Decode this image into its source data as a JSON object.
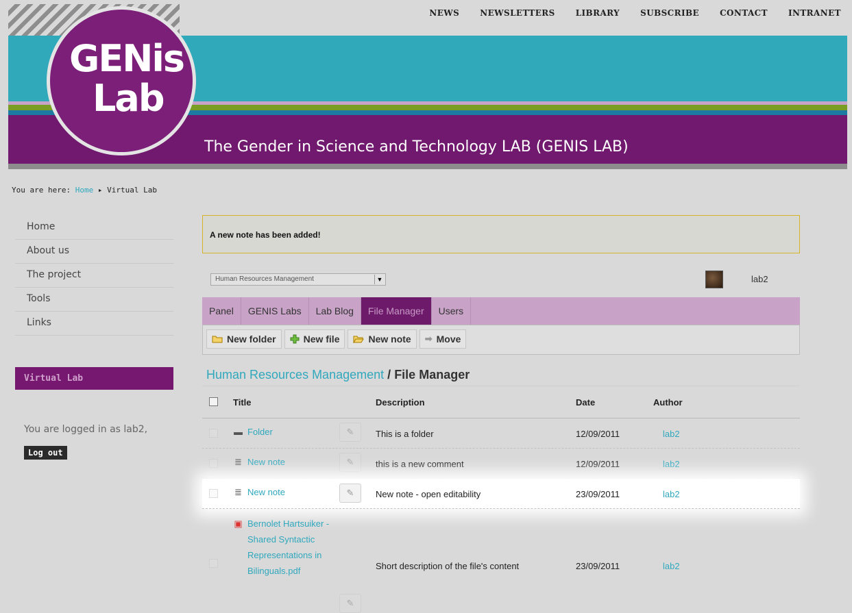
{
  "topnav": [
    "NEWS",
    "NEWSLETTERS",
    "LIBRARY",
    "SUBSCRIBE",
    "CONTACT",
    "INTRANET"
  ],
  "logo": {
    "line1": "GENis",
    "line2": "Lab"
  },
  "site_title": "The Gender in Science and Technology LAB (GENIS LAB)",
  "breadcrumb": {
    "prefix": "You are here:",
    "home": "Home",
    "separator": "▸",
    "current": "Virtual Lab"
  },
  "sidebar": {
    "items": [
      "Home",
      "About us",
      "The project",
      "Tools",
      "Links"
    ],
    "section_title": "Virtual Lab",
    "logged_in_text": "You are logged in as lab2,",
    "logout_label": "Log out"
  },
  "notice": "A new note has been added!",
  "lab_select": {
    "value": "Human Resources Management"
  },
  "user": {
    "name": "lab2"
  },
  "tabs": [
    {
      "label": "Panel",
      "active": false
    },
    {
      "label": "GENIS Labs",
      "active": false
    },
    {
      "label": "Lab Blog",
      "active": false
    },
    {
      "label": "File Manager",
      "active": true
    },
    {
      "label": "Users",
      "active": false
    }
  ],
  "toolbar": {
    "new_folder": "New folder",
    "new_file": "New file",
    "new_note": "New note",
    "move": "Move"
  },
  "file_manager": {
    "lab_link": "Human Resources Management",
    "separator": "/",
    "title": "File Manager",
    "columns": {
      "title": "Title",
      "description": "Description",
      "date": "Date",
      "author": "Author"
    },
    "rows": [
      {
        "type": "folder",
        "title": "Folder",
        "description": "This is a folder",
        "date": "12/09/2011",
        "author": "lab2"
      },
      {
        "type": "note",
        "title": "New note",
        "description": "this is a new comment",
        "date": "12/09/2011",
        "author": "lab2"
      },
      {
        "type": "note",
        "title": "New note",
        "description": "New note - open editability",
        "date": "23/09/2011",
        "author": "lab2"
      },
      {
        "type": "pdf",
        "title": [
          "Bernolet Hartsuiker -",
          "Shared Syntactic",
          "Representations in",
          "Bilinguals.pdf"
        ],
        "description": "Short description of the file's content",
        "date": "23/09/2011",
        "author": "lab2"
      }
    ]
  },
  "colors": {
    "teal": "#30aabb",
    "purple": "#70196e",
    "link": "#2fa8bd",
    "notice_border": "#d5b429"
  }
}
